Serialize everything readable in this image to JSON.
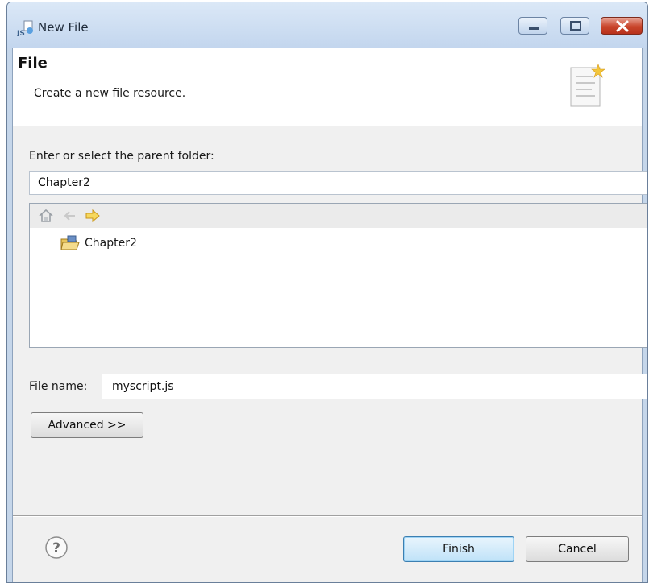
{
  "window": {
    "title": "New File",
    "app_icon": "javascript-file-icon",
    "controls": [
      "minimize-icon",
      "maximize-icon",
      "close-icon"
    ]
  },
  "header": {
    "title": "File",
    "description": "Create a new file resource.",
    "banner_icon": "new-file-wizard-icon"
  },
  "parent_folder": {
    "label": "Enter or select the parent folder:",
    "value": "Chapter2"
  },
  "tree": {
    "toolbar_icons": [
      "home-icon",
      "back-icon",
      "forward-icon"
    ],
    "items": [
      {
        "label": "Chapter2",
        "icon": "project-folder-icon"
      }
    ]
  },
  "file_name": {
    "label": "File name:",
    "value": "myscript.js"
  },
  "buttons": {
    "advanced": "Advanced >>",
    "finish": "Finish",
    "cancel": "Cancel"
  },
  "colors": {
    "title_bar": "#c5d6ea",
    "close_button": "#c9452b",
    "default_button_accent": "#3c7fb1",
    "forward_arrow": "#e3b21f"
  }
}
